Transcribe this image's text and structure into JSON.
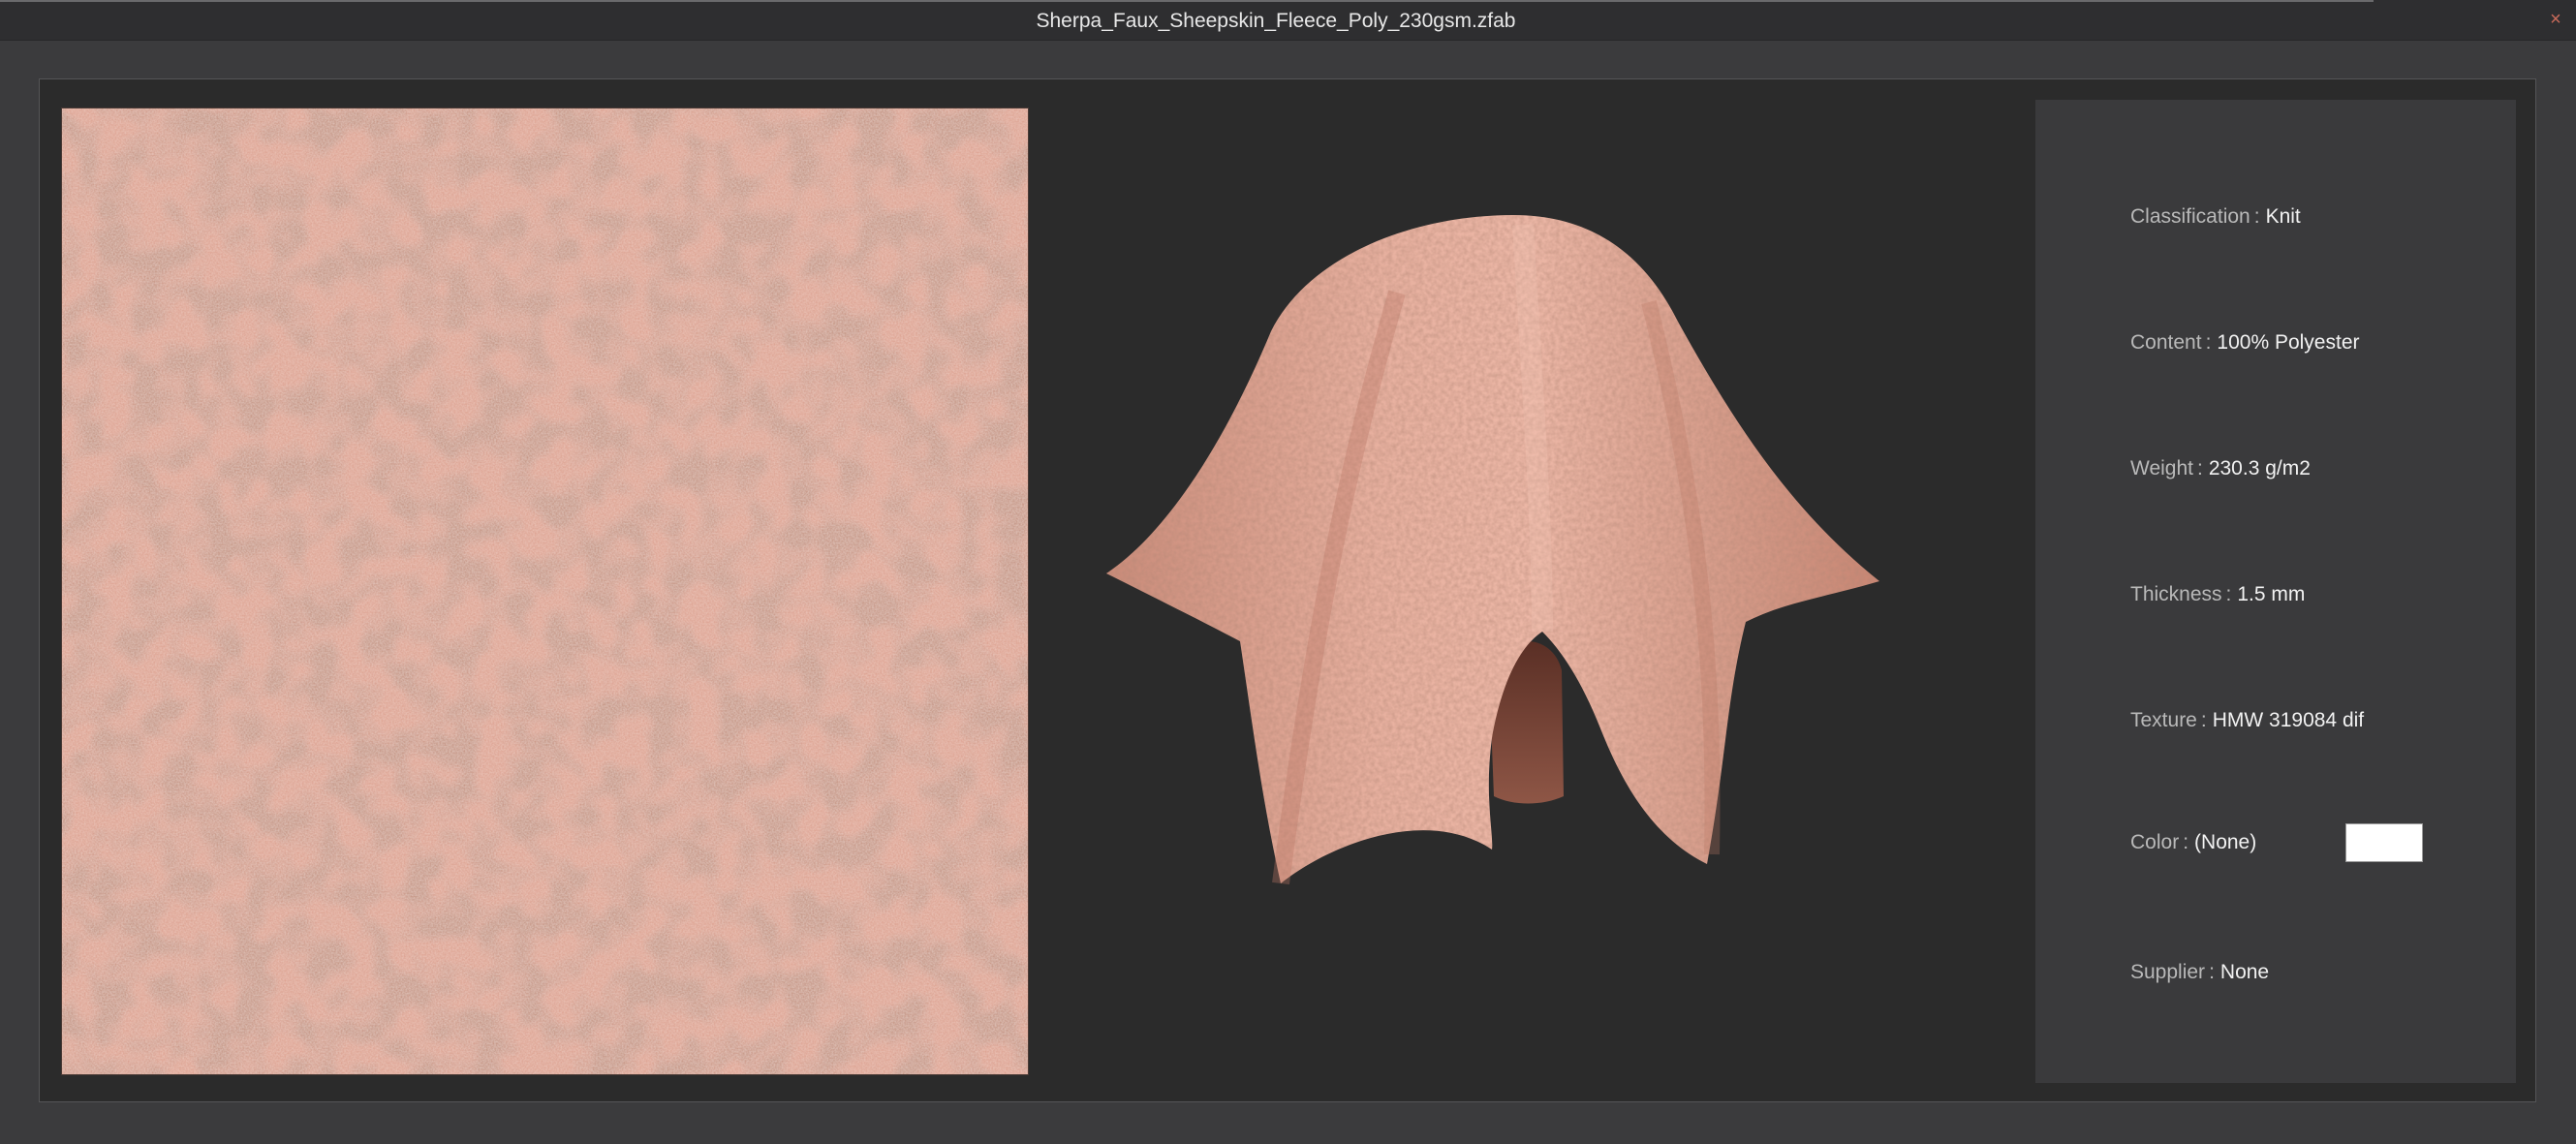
{
  "window": {
    "title": "Sherpa_Faux_Sheepskin_Fleece_Poly_230gsm.zfab",
    "close_glyph": "×"
  },
  "icons": {
    "close": "close-icon"
  },
  "colors": {
    "fabric_base": "#dca190",
    "fabric_shadow": "#b4705c",
    "fabric_highlight": "#f0c8bb",
    "color_chip": "#ffffff",
    "background": "#2b2b2b",
    "panel": "#3a3a3c"
  },
  "properties": {
    "separator": ":",
    "classification": {
      "label": "Classification",
      "value": "Knit"
    },
    "content": {
      "label": "Content",
      "value": "100% Polyester"
    },
    "weight": {
      "label": "Weight",
      "value": "230.3 g/m2"
    },
    "thickness": {
      "label": "Thickness",
      "value": "1.5 mm"
    },
    "texture": {
      "label": "Texture",
      "value": "HMW 319084 dif"
    },
    "color": {
      "label": "Color",
      "value": "(None)"
    },
    "supplier": {
      "label": "Supplier",
      "value": "None"
    }
  }
}
